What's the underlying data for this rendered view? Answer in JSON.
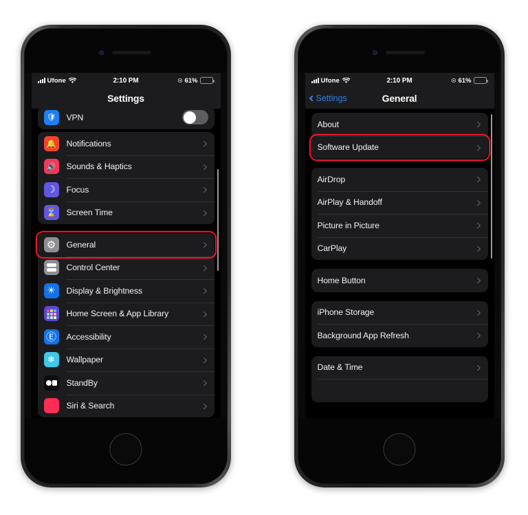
{
  "meta": {
    "highlight_color": "#e8182c",
    "accent_blue": "#3b86ee"
  },
  "status_bar": {
    "carrier": "Ufone",
    "time": "2:10 PM",
    "battery_percent": "61%",
    "battery_level": 61,
    "signal_icon": "cellular-bars-icon",
    "wifi_icon": "wifi-icon",
    "lock_icon": "rotation-lock-icon"
  },
  "left_phone": {
    "nav": {
      "title": "Settings"
    },
    "partial_top_row": {
      "label": "VPN",
      "icon": "vpn-shield-icon",
      "icon_color": "#1d7ff0",
      "toggle_on": false
    },
    "groups": [
      {
        "rows": [
          {
            "label": "Notifications",
            "icon": "bell-icon",
            "icon_color": "#f4432f",
            "chevron": true
          },
          {
            "label": "Sounds & Haptics",
            "icon": "speaker-icon",
            "icon_color": "#f2395c",
            "chevron": true
          },
          {
            "label": "Focus",
            "icon": "moon-icon",
            "icon_color": "#6257e0",
            "chevron": true
          },
          {
            "label": "Screen Time",
            "icon": "hourglass-icon",
            "icon_color": "#6257e0",
            "chevron": true
          }
        ]
      },
      {
        "rows": [
          {
            "label": "General",
            "icon": "gear-icon",
            "icon_color": "#8e8e93",
            "chevron": true,
            "highlight": true
          },
          {
            "label": "Control Center",
            "icon": "control-center-icon",
            "icon_color": "#8e8e93",
            "chevron": true
          },
          {
            "label": "Display & Brightness",
            "icon": "brightness-icon",
            "icon_color": "#1472e8",
            "chevron": true
          },
          {
            "label": "Home Screen & App Library",
            "icon": "app-grid-icon",
            "icon_color": "#5a48d6",
            "chevron": true
          },
          {
            "label": "Accessibility",
            "icon": "accessibility-icon",
            "icon_color": "#1472e8",
            "chevron": true
          },
          {
            "label": "Wallpaper",
            "icon": "wallpaper-icon",
            "icon_color": "#40c8e8",
            "chevron": true
          },
          {
            "label": "StandBy",
            "icon": "standby-icon",
            "icon_color": "#0d0d0f",
            "chevron": true
          },
          {
            "label": "Siri & Search",
            "icon": "siri-icon",
            "icon_color": "#ff2d55",
            "chevron": true
          }
        ]
      }
    ]
  },
  "right_phone": {
    "nav": {
      "back_label": "Settings",
      "title": "General",
      "back_icon": "chevron-left-icon"
    },
    "groups": [
      {
        "rows": [
          {
            "label": "About",
            "chevron": true
          },
          {
            "label": "Software Update",
            "chevron": true,
            "highlight": true
          }
        ]
      },
      {
        "rows": [
          {
            "label": "AirDrop",
            "chevron": true
          },
          {
            "label": "AirPlay & Handoff",
            "chevron": true
          },
          {
            "label": "Picture in Picture",
            "chevron": true
          },
          {
            "label": "CarPlay",
            "chevron": true
          }
        ]
      },
      {
        "rows": [
          {
            "label": "Home Button",
            "chevron": true
          }
        ]
      },
      {
        "rows": [
          {
            "label": "iPhone Storage",
            "chevron": true
          },
          {
            "label": "Background App Refresh",
            "chevron": true
          }
        ]
      },
      {
        "rows": [
          {
            "label": "Date & Time",
            "chevron": true
          },
          {
            "label": "",
            "chevron": false
          }
        ]
      }
    ]
  }
}
